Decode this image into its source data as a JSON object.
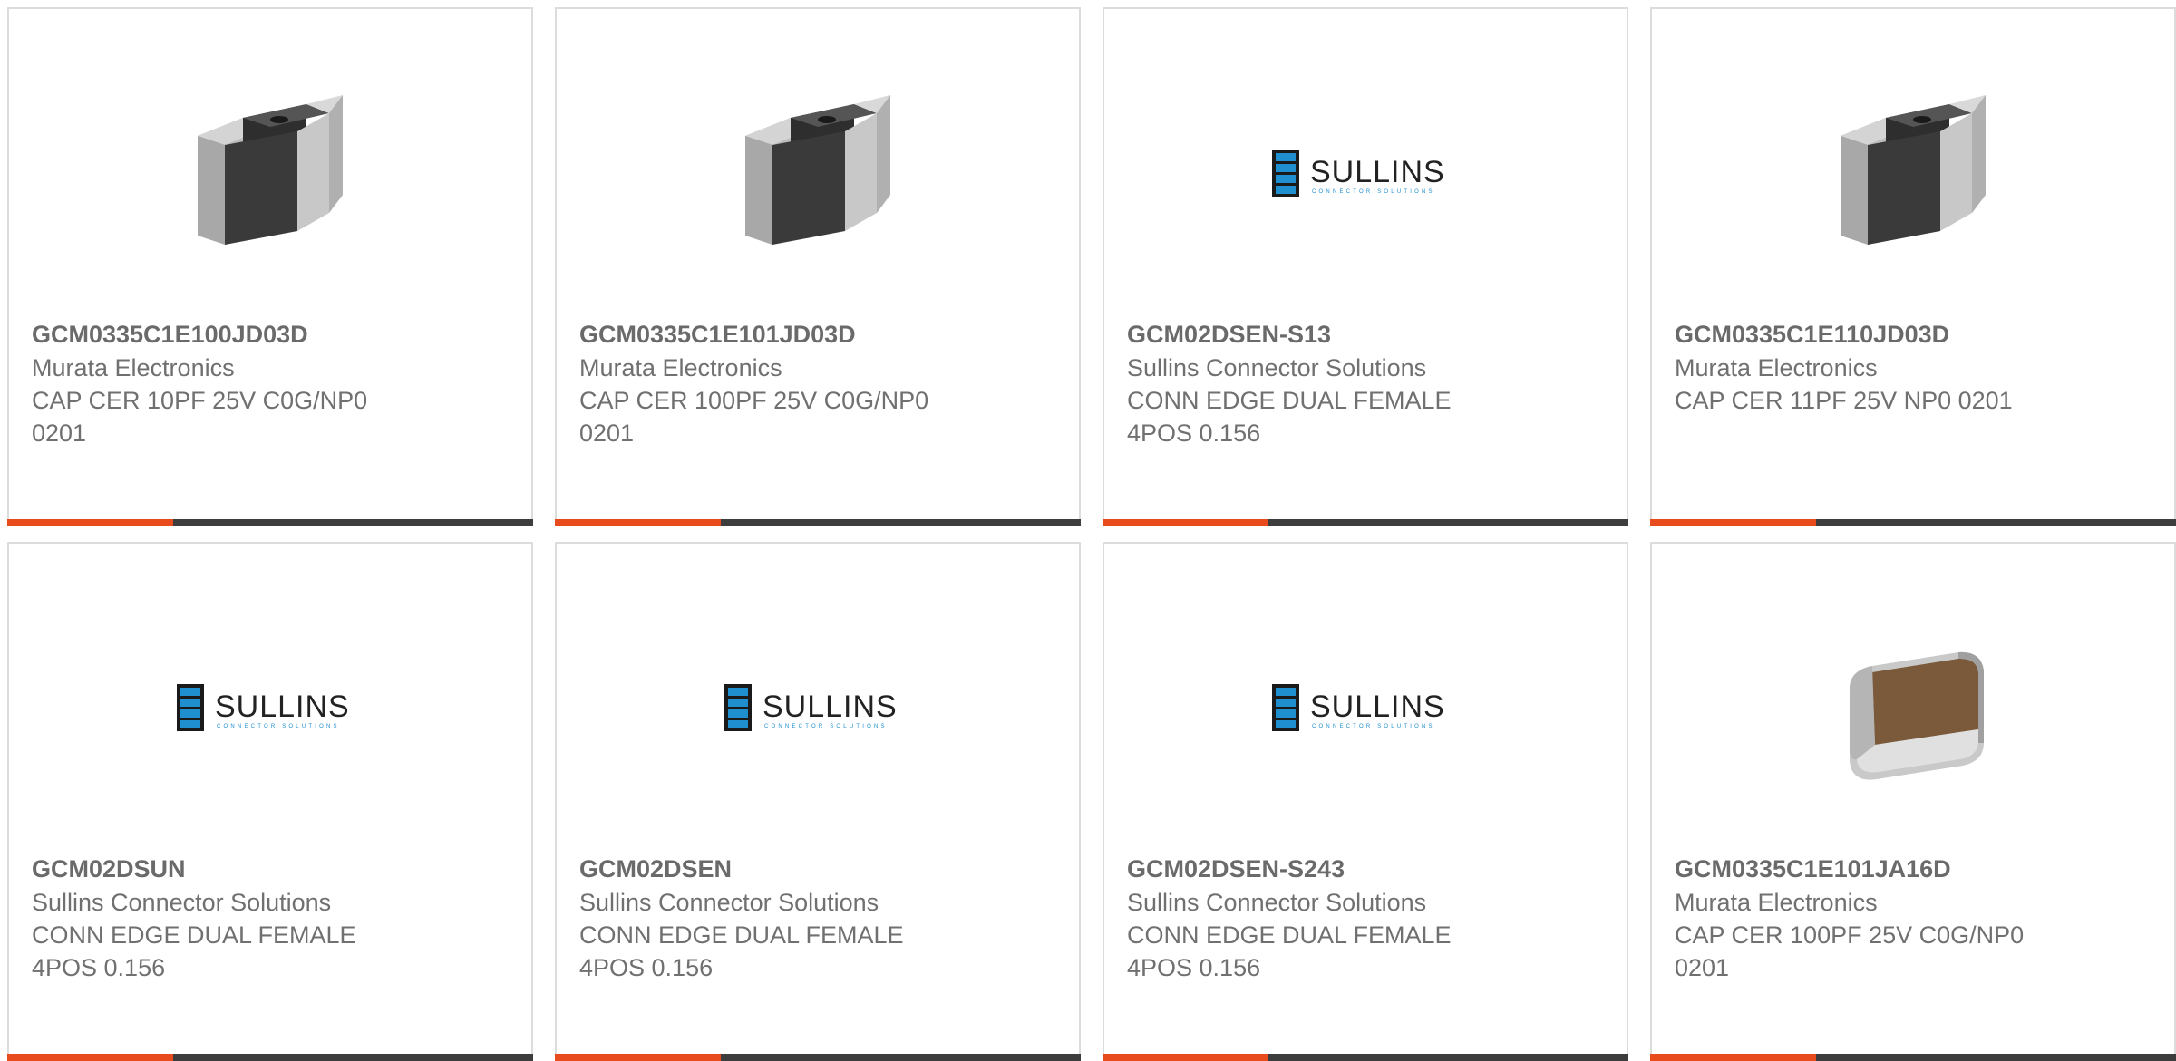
{
  "colors": {
    "accent": "#e84c1c",
    "bar": "#3d3d3d",
    "border": "#dcdcdc"
  },
  "products": [
    {
      "part": "GCM0335C1E100JD03D",
      "maker": "Murata Electronics",
      "desc1": "CAP CER 10PF 25V C0G/NP0",
      "desc2": "0201",
      "image": "chip-capacitor-image"
    },
    {
      "part": "GCM0335C1E101JD03D",
      "maker": "Murata Electronics",
      "desc1": "CAP CER 100PF 25V C0G/NP0",
      "desc2": "0201",
      "image": "chip-capacitor-image"
    },
    {
      "part": "GCM02DSEN-S13",
      "maker": "Sullins Connector Solutions",
      "desc1": "CONN EDGE DUAL FEMALE",
      "desc2": "4POS 0.156",
      "image": "sullins-logo"
    },
    {
      "part": "GCM0335C1E110JD03D",
      "maker": "Murata Electronics",
      "desc1": "CAP CER 11PF 25V NP0 0201",
      "desc2": "",
      "image": "chip-capacitor-image"
    },
    {
      "part": "GCM02DSUN",
      "maker": "Sullins Connector Solutions",
      "desc1": "CONN EDGE DUAL FEMALE",
      "desc2": "4POS 0.156",
      "image": "sullins-logo"
    },
    {
      "part": "GCM02DSEN",
      "maker": "Sullins Connector Solutions",
      "desc1": "CONN EDGE DUAL FEMALE",
      "desc2": "4POS 0.156",
      "image": "sullins-logo"
    },
    {
      "part": "GCM02DSEN-S243",
      "maker": "Sullins Connector Solutions",
      "desc1": "CONN EDGE DUAL FEMALE",
      "desc2": "4POS 0.156",
      "image": "sullins-logo"
    },
    {
      "part": "GCM0335C1E101JA16D",
      "maker": "Murata Electronics",
      "desc1": "CAP CER 100PF 25V C0G/NP0",
      "desc2": "0201",
      "image": "brown-capacitor-image"
    }
  ],
  "logo": {
    "brand": "SULLINS",
    "tagline": "CONNECTOR SOLUTIONS"
  }
}
